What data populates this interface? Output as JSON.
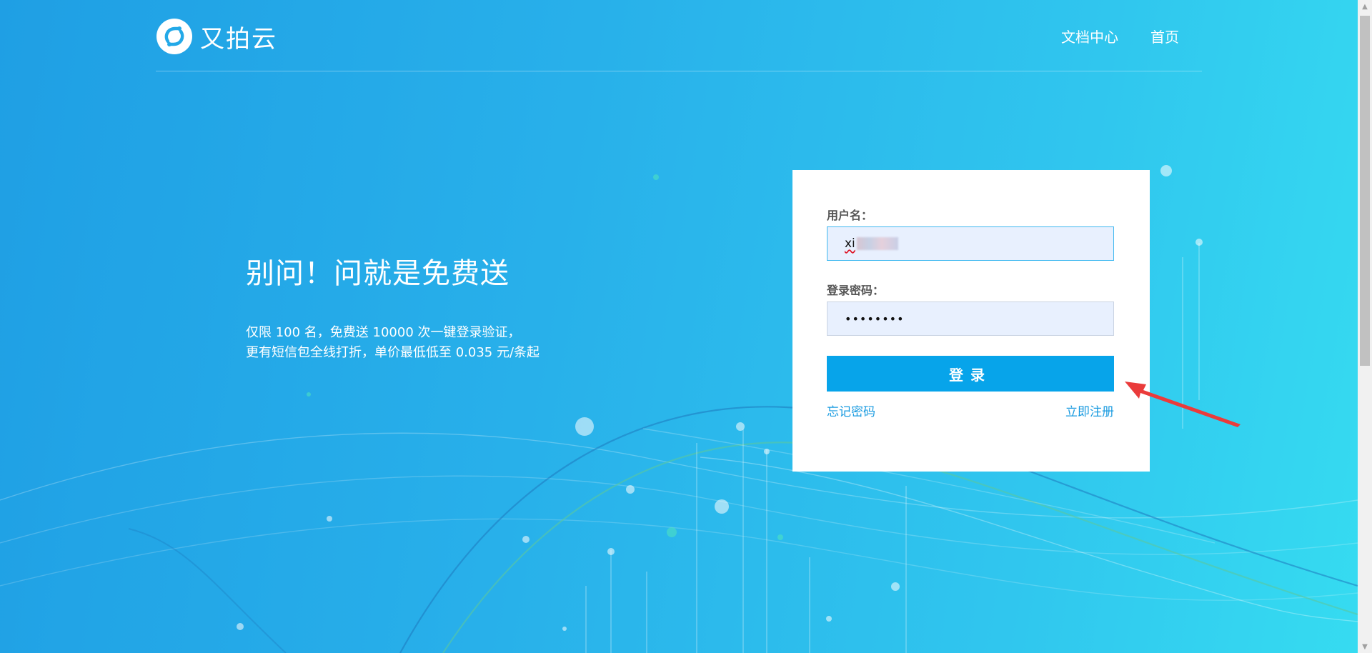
{
  "brand": {
    "name": "又拍云"
  },
  "nav": {
    "docs": "文档中心",
    "home": "首页"
  },
  "promo": {
    "title": "别问！问就是免费送",
    "line1": "仅限 100 名，免费送 10000 次一键登录验证，",
    "line2": "更有短信包全线打折，单价最低低至 0.035 元/条起"
  },
  "login": {
    "username_label": "用户名：",
    "username_value": "xi",
    "password_label": "登录密码：",
    "password_value": "••••••••",
    "submit_label": "登录",
    "forgot_label": "忘记密码",
    "register_label": "立即注册"
  },
  "colors": {
    "background_start": "#1f9fe4",
    "background_end": "#36dcf1",
    "button": "#07a4ea",
    "link": "#1a9be0",
    "annotation_arrow": "#ea3b3b"
  },
  "icons": {
    "logo": "upyun-logo-icon",
    "annotation": "red-arrow-icon",
    "scroll_up": "scroll-up-arrow-icon",
    "scroll_down": "scroll-down-arrow-icon"
  }
}
